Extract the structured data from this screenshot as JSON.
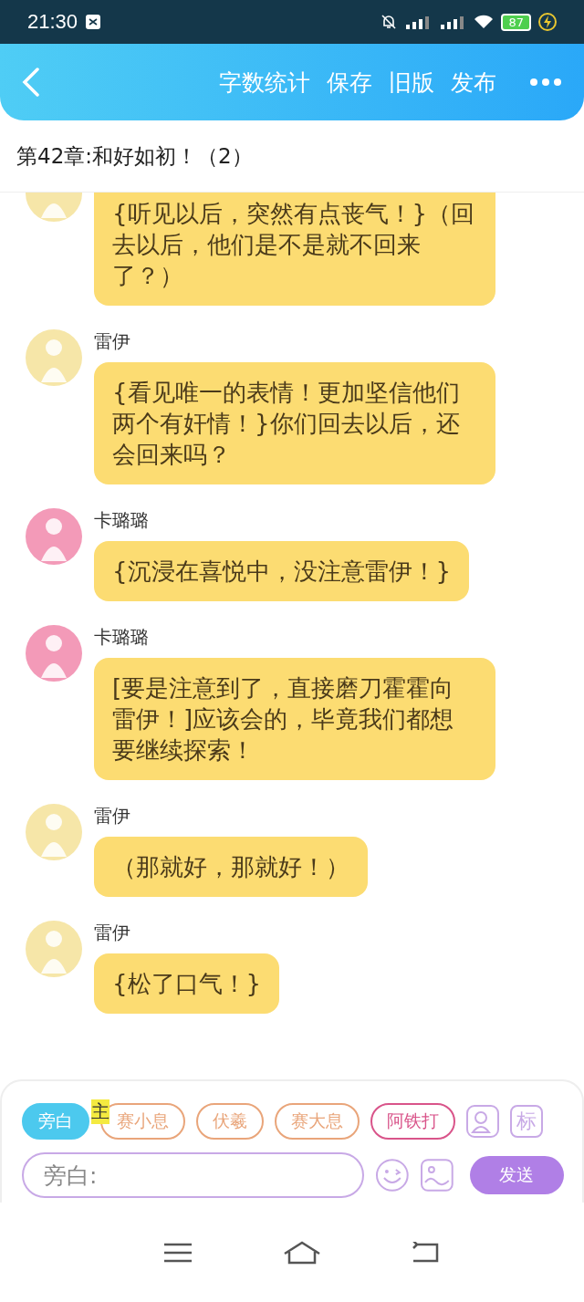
{
  "status_bar": {
    "time": "21:30",
    "battery": "87"
  },
  "header": {
    "actions": [
      "字数统计",
      "保存",
      "旧版",
      "发布"
    ]
  },
  "chapter_title": "第42章:和好如初！（2）",
  "messages": [
    {
      "color": "#f6e6a8",
      "text": "{听见以后，突然有点丧气！}（回去以后，他们是不是就不回来了？）"
    },
    {
      "name": "雷伊",
      "color": "#f6e6a8",
      "text": "{看见唯一的表情！更加坚信他们两个有奸情！}你们回去以后，还会回来吗？"
    },
    {
      "name": "卡璐璐",
      "color": "#f39ab8",
      "text": "{沉浸在喜悦中，没注意雷伊！}"
    },
    {
      "name": "卡璐璐",
      "color": "#f39ab8",
      "text": "[要是注意到了，直接磨刀霍霍向雷伊！]应该会的，毕竟我们都想要继续探索！"
    },
    {
      "name": "雷伊",
      "color": "#f6e6a8",
      "text": "（那就好，那就好！）"
    },
    {
      "name": "雷伊",
      "color": "#f6e6a8",
      "text": "{松了口气！}"
    }
  ],
  "composer": {
    "roles": [
      {
        "label": "旁白",
        "selected": true,
        "color": "#4cc9ee"
      },
      {
        "label": "赛小息",
        "selected": false,
        "color": "#e9a57a"
      },
      {
        "label": "伏羲",
        "selected": false,
        "color": "#e9a57a"
      },
      {
        "label": "赛大息",
        "selected": false,
        "color": "#e9a57a"
      },
      {
        "label": "阿铁打",
        "selected": false,
        "color": "#d9548a"
      }
    ],
    "main_tag": "主",
    "tag_button": "标",
    "input": {
      "placeholder": "旁白:"
    },
    "send": "发送"
  }
}
